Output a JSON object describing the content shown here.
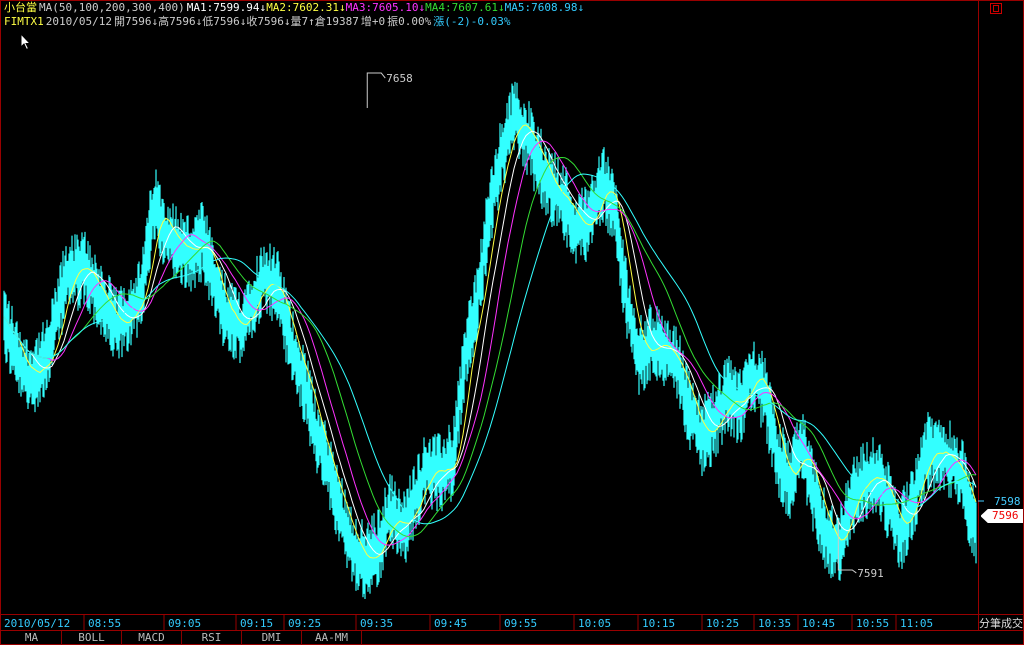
{
  "header": {
    "product": "小台當",
    "ma_params": "MA(50,100,200,300,400)",
    "ma1": "MA1:7599.94↓",
    "ma2": "MA2:7602.31↓",
    "ma3": "MA3:7605.10↓",
    "ma4": "MA4:7607.61↓",
    "ma5": "MA5:7608.98↓",
    "symbol": "FIMTX1",
    "date": "2010/05/12",
    "open": "開7596↓",
    "high": "高7596↓",
    "low": "低7596↓",
    "close": "收7596↓",
    "volume": "量7↑",
    "oi": "倉19387",
    "change": "增+0",
    "amplitude": "振0.00%",
    "pct": "漲(-2)-0.03%"
  },
  "side_label": "分筆成交",
  "tabs": [
    "MA",
    "BOLL",
    "MACD",
    "RSI",
    "DMI",
    "AA-MM"
  ],
  "colors": {
    "background": "#000000",
    "frame": "#990000",
    "price": "#33ffff",
    "ma1": "#ffffff",
    "ma2": "#ffff44",
    "ma3": "#ff33ff",
    "ma4": "#33dd33",
    "ma5": "#33ffff",
    "last_tag": "#ffffff",
    "last_text": "#ff0000"
  },
  "chart_data": {
    "type": "line",
    "x_ticks": [
      "2010/05/12",
      "08:55",
      "09:05",
      "09:15",
      "09:25",
      "09:35",
      "09:45",
      "09:55",
      "10:05",
      "10:15",
      "10:25",
      "10:35",
      "10:45",
      "10:55",
      "11:05"
    ],
    "ylim": [
      7585,
      7664
    ],
    "annotations": [
      {
        "label": "7658",
        "time_min": 58.3,
        "value": 7658
      },
      {
        "label": "7591",
        "time_min": 133.9,
        "value": 7591
      }
    ],
    "right_label": "7598",
    "last_label": "7596",
    "price_keypoints": [
      {
        "t": 0,
        "v": 7625
      },
      {
        "t": 2,
        "v": 7620
      },
      {
        "t": 4,
        "v": 7617
      },
      {
        "t": 7,
        "v": 7620
      },
      {
        "t": 10,
        "v": 7631
      },
      {
        "t": 13,
        "v": 7632
      },
      {
        "t": 16,
        "v": 7627
      },
      {
        "t": 18,
        "v": 7624
      },
      {
        "t": 20,
        "v": 7626
      },
      {
        "t": 22,
        "v": 7628
      },
      {
        "t": 24,
        "v": 7641
      },
      {
        "t": 26,
        "v": 7637
      },
      {
        "t": 28,
        "v": 7635
      },
      {
        "t": 30,
        "v": 7634
      },
      {
        "t": 32,
        "v": 7636
      },
      {
        "t": 34,
        "v": 7629
      },
      {
        "t": 36,
        "v": 7625
      },
      {
        "t": 38,
        "v": 7624
      },
      {
        "t": 40,
        "v": 7628
      },
      {
        "t": 42,
        "v": 7631
      },
      {
        "t": 44,
        "v": 7629
      },
      {
        "t": 46,
        "v": 7622
      },
      {
        "t": 48,
        "v": 7617
      },
      {
        "t": 50,
        "v": 7610
      },
      {
        "t": 52,
        "v": 7605
      },
      {
        "t": 54,
        "v": 7599
      },
      {
        "t": 56,
        "v": 7594
      },
      {
        "t": 58,
        "v": 7592
      },
      {
        "t": 60,
        "v": 7594
      },
      {
        "t": 62,
        "v": 7599
      },
      {
        "t": 64,
        "v": 7596
      },
      {
        "t": 66,
        "v": 7601
      },
      {
        "t": 68,
        "v": 7605
      },
      {
        "t": 70,
        "v": 7604
      },
      {
        "t": 72,
        "v": 7606
      },
      {
        "t": 74,
        "v": 7620
      },
      {
        "t": 76,
        "v": 7628
      },
      {
        "t": 78,
        "v": 7640
      },
      {
        "t": 80,
        "v": 7648
      },
      {
        "t": 82,
        "v": 7653
      },
      {
        "t": 84,
        "v": 7650
      },
      {
        "t": 86,
        "v": 7646
      },
      {
        "t": 88,
        "v": 7643
      },
      {
        "t": 90,
        "v": 7641
      },
      {
        "t": 92,
        "v": 7637
      },
      {
        "t": 94,
        "v": 7639
      },
      {
        "t": 96,
        "v": 7644
      },
      {
        "t": 98,
        "v": 7640
      },
      {
        "t": 100,
        "v": 7627
      },
      {
        "t": 102,
        "v": 7620
      },
      {
        "t": 104,
        "v": 7622
      },
      {
        "t": 106,
        "v": 7621
      },
      {
        "t": 108,
        "v": 7619
      },
      {
        "t": 110,
        "v": 7613
      },
      {
        "t": 112,
        "v": 7609
      },
      {
        "t": 114,
        "v": 7611
      },
      {
        "t": 116,
        "v": 7615
      },
      {
        "t": 118,
        "v": 7613
      },
      {
        "t": 120,
        "v": 7618
      },
      {
        "t": 122,
        "v": 7615
      },
      {
        "t": 124,
        "v": 7607
      },
      {
        "t": 126,
        "v": 7603
      },
      {
        "t": 128,
        "v": 7608
      },
      {
        "t": 130,
        "v": 7601
      },
      {
        "t": 132,
        "v": 7596
      },
      {
        "t": 134,
        "v": 7594
      },
      {
        "t": 136,
        "v": 7601
      },
      {
        "t": 138,
        "v": 7603
      },
      {
        "t": 140,
        "v": 7604
      },
      {
        "t": 142,
        "v": 7600
      },
      {
        "t": 144,
        "v": 7596
      },
      {
        "t": 146,
        "v": 7601
      },
      {
        "t": 148,
        "v": 7607
      },
      {
        "t": 150,
        "v": 7607
      },
      {
        "t": 152,
        "v": 7606
      },
      {
        "t": 154,
        "v": 7603
      },
      {
        "t": 156,
        "v": 7596
      }
    ]
  }
}
